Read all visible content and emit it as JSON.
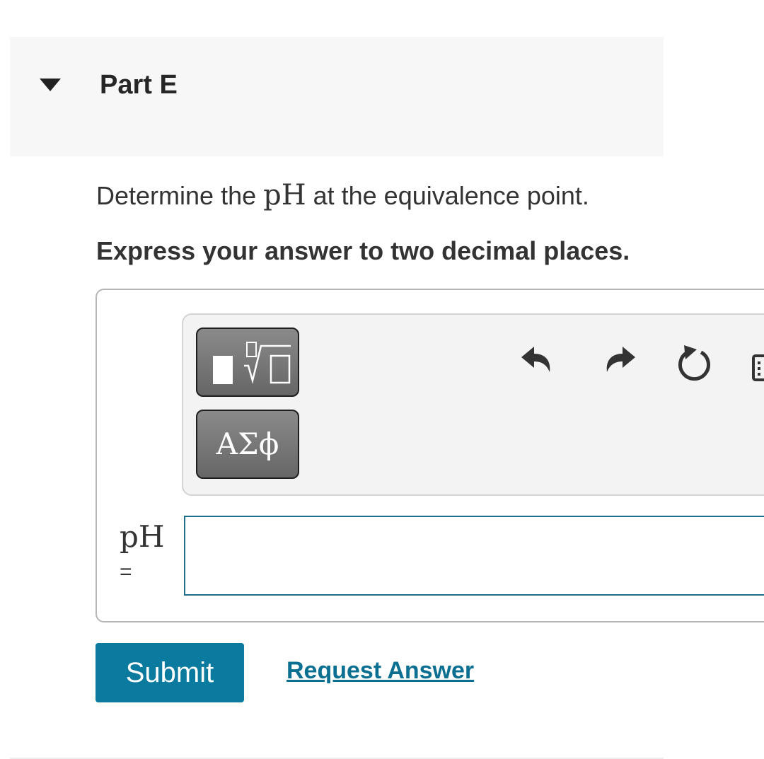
{
  "part": {
    "title": "Part E",
    "caret_icon": "caret-down-icon"
  },
  "question": {
    "prefix": "Determine the ",
    "math": "pH",
    "suffix": " at the equivalence point."
  },
  "instruction": "Express your answer to two decimal places.",
  "toolbar": {
    "templates_icon": "templates-radical-icon",
    "symbols_label": "ΑΣϕ",
    "undo_icon": "undo-icon",
    "redo_icon": "redo-icon",
    "reset_icon": "reset-icon",
    "keyboard_icon": "keyboard-icon"
  },
  "answer": {
    "label": "pH",
    "equals": "=",
    "value": ""
  },
  "actions": {
    "submit_label": "Submit",
    "request_label": "Request Answer"
  },
  "colors": {
    "primary": "#0a7a9e",
    "link": "#0a6f91",
    "input_border": "#1f6f8b"
  }
}
